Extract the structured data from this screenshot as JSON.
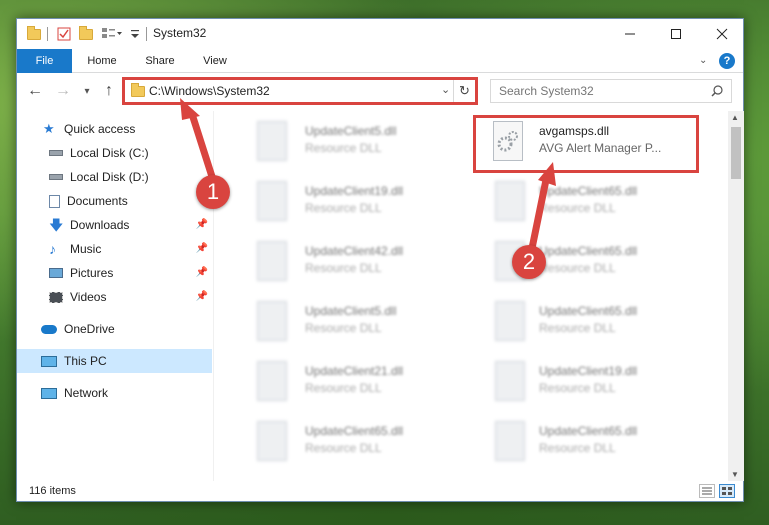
{
  "window": {
    "title": "System32"
  },
  "ribbon": {
    "tabs": [
      "File",
      "Home",
      "Share",
      "View"
    ]
  },
  "address": {
    "path": "C:\\Windows\\System32",
    "search_placeholder": "Search System32"
  },
  "nav": {
    "items": [
      {
        "label": "Quick access"
      },
      {
        "label": "Local Disk (C:)"
      },
      {
        "label": "Local Disk (D:)"
      },
      {
        "label": "Documents"
      },
      {
        "label": "Downloads"
      },
      {
        "label": "Music"
      },
      {
        "label": "Pictures"
      },
      {
        "label": "Videos"
      },
      {
        "label": "OneDrive"
      },
      {
        "label": "This PC"
      },
      {
        "label": "Network"
      }
    ]
  },
  "files": {
    "left": [
      {
        "name": "UpdateClient5.dll",
        "type": "Resource DLL"
      },
      {
        "name": "UpdateClient19.dll",
        "type": "Resource DLL"
      },
      {
        "name": "UpdateClient42.dll",
        "type": "Resource DLL"
      },
      {
        "name": "UpdateClient5.dll",
        "type": "Resource DLL"
      },
      {
        "name": "UpdateClient21.dll",
        "type": "Resource DLL"
      },
      {
        "name": "UpdateClient65.dll",
        "type": "Resource DLL"
      }
    ],
    "right": [
      {
        "name": "avgamsps.dll",
        "type": "AVG Alert Manager P..."
      },
      {
        "name": "UpdateClient65.dll",
        "type": "Resource DLL"
      },
      {
        "name": "UpdateClient65.dll",
        "type": "Resource DLL"
      },
      {
        "name": "UpdateClient65.dll",
        "type": "Resource DLL"
      },
      {
        "name": "UpdateClient19.dll",
        "type": "Resource DLL"
      },
      {
        "name": "UpdateClient65.dll",
        "type": "Resource DLL"
      }
    ]
  },
  "status": {
    "count": "116 items"
  },
  "annotations": {
    "step1": "1",
    "step2": "2",
    "highlight_color": "#d9443f"
  }
}
